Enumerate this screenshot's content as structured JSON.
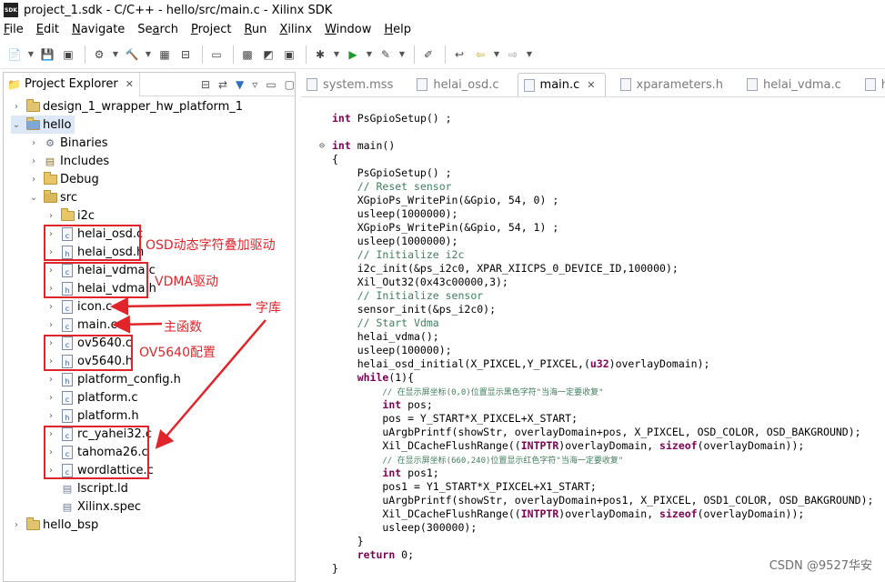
{
  "window": {
    "title": "project_1.sdk - C/C++ - hello/src/main.c - Xilinx SDK",
    "logo_text": "SDK"
  },
  "menu": [
    {
      "label": "File",
      "mn": "F",
      "rest": "ile"
    },
    {
      "label": "Edit",
      "mn": "E",
      "rest": "dit"
    },
    {
      "label": "Navigate",
      "mn": "N",
      "rest": "avigate"
    },
    {
      "label": "Search",
      "mn": "a",
      "pre": "Se",
      "rest": "rch"
    },
    {
      "label": "Project",
      "mn": "P",
      "rest": "roject"
    },
    {
      "label": "Run",
      "mn": "R",
      "rest": "un"
    },
    {
      "label": "Xilinx",
      "mn": "X",
      "rest": "ilinx"
    },
    {
      "label": "Window",
      "mn": "W",
      "rest": "indow"
    },
    {
      "label": "Help",
      "mn": "H",
      "rest": "elp"
    }
  ],
  "explorer": {
    "tab_label": "Project Explorer",
    "items": [
      {
        "label": "design_1_wrapper_hw_platform_1",
        "level": 0,
        "arrow": "›",
        "icon": "project-icon"
      },
      {
        "label": "hello",
        "level": 0,
        "arrow": "⌄",
        "icon": "c-project-icon",
        "selected": true
      },
      {
        "label": "Binaries",
        "level": 1,
        "arrow": "›",
        "icon": "binaries-icon"
      },
      {
        "label": "Includes",
        "level": 1,
        "arrow": "›",
        "icon": "includes-icon"
      },
      {
        "label": "Debug",
        "level": 1,
        "arrow": "›",
        "icon": "folder-icon"
      },
      {
        "label": "src",
        "level": 1,
        "arrow": "⌄",
        "icon": "source-folder-icon"
      },
      {
        "label": "i2c",
        "level": 2,
        "arrow": "›",
        "icon": "folder-icon"
      },
      {
        "label": "helai_osd.c",
        "level": 2,
        "arrow": "›",
        "icon": "c-file-icon"
      },
      {
        "label": "helai_osd.h",
        "level": 2,
        "arrow": "›",
        "icon": "h-file-icon"
      },
      {
        "label": "helai_vdma.c",
        "level": 2,
        "arrow": "›",
        "icon": "c-file-icon"
      },
      {
        "label": "helai_vdma.h",
        "level": 2,
        "arrow": "›",
        "icon": "h-file-icon"
      },
      {
        "label": "icon.c",
        "level": 2,
        "arrow": "›",
        "icon": "c-file-icon"
      },
      {
        "label": "main.c",
        "level": 2,
        "arrow": "›",
        "icon": "c-file-icon"
      },
      {
        "label": "ov5640.c",
        "level": 2,
        "arrow": "›",
        "icon": "c-file-icon"
      },
      {
        "label": "ov5640.h",
        "level": 2,
        "arrow": "›",
        "icon": "h-file-icon"
      },
      {
        "label": "platform_config.h",
        "level": 2,
        "arrow": "›",
        "icon": "h-file-icon"
      },
      {
        "label": "platform.c",
        "level": 2,
        "arrow": "›",
        "icon": "c-file-icon"
      },
      {
        "label": "platform.h",
        "level": 2,
        "arrow": "›",
        "icon": "h-file-icon"
      },
      {
        "label": "rc_yahei32.c",
        "level": 2,
        "arrow": "›",
        "icon": "c-file-icon"
      },
      {
        "label": "tahoma26.c",
        "level": 2,
        "arrow": "›",
        "icon": "c-file-icon"
      },
      {
        "label": "wordlattice.c",
        "level": 2,
        "arrow": "›",
        "icon": "c-file-icon"
      },
      {
        "label": "lscript.ld",
        "level": 2,
        "arrow": "",
        "icon": "linker-script-icon"
      },
      {
        "label": "Xilinx.spec",
        "level": 2,
        "arrow": "",
        "icon": "spec-file-icon"
      },
      {
        "label": "hello_bsp",
        "level": 0,
        "arrow": "›",
        "icon": "bsp-project-icon"
      }
    ]
  },
  "annotations": {
    "osd": "OSD动态字符叠加驱动",
    "vdma": "VDMA驱动",
    "font_lib": "字库",
    "main_fn": "主函数",
    "ov5640": "OV5640配置",
    "color": "#e0242a"
  },
  "editor": {
    "tabs": [
      {
        "label": "system.mss",
        "active": false
      },
      {
        "label": "helai_osd.c",
        "active": false
      },
      {
        "label": "main.c",
        "active": true
      },
      {
        "label": "xparameters.h",
        "active": false
      },
      {
        "label": "helai_vdma.c",
        "active": false
      },
      {
        "label": "helai_osd",
        "active": false
      }
    ],
    "code_lines": [
      [
        [
          "kw",
          "int"
        ],
        [
          "t",
          " PsGpioSetup() ;"
        ]
      ],
      [
        [
          "t",
          ""
        ]
      ],
      [
        [
          "kw",
          "int"
        ],
        [
          "t",
          " main()"
        ]
      ],
      [
        [
          "t",
          "{"
        ]
      ],
      [
        [
          "t",
          "    PsGpioSetup() ;"
        ]
      ],
      [
        [
          "t",
          "    "
        ],
        [
          "cm",
          "// Reset sensor"
        ]
      ],
      [
        [
          "t",
          "    XGpioPs_WritePin(&Gpio, 54, 0) ;"
        ]
      ],
      [
        [
          "t",
          "    usleep(1000000);"
        ]
      ],
      [
        [
          "t",
          "    XGpioPs_WritePin(&Gpio, 54, 1) ;"
        ]
      ],
      [
        [
          "t",
          "    usleep(1000000);"
        ]
      ],
      [
        [
          "t",
          "    "
        ],
        [
          "cm",
          "// Initialize i2c"
        ]
      ],
      [
        [
          "t",
          "    i2c_init(&ps_i2c0, XPAR_XIICPS_0_DEVICE_ID,100000);"
        ]
      ],
      [
        [
          "t",
          "    Xil_Out32(0x43c00000,3);"
        ]
      ],
      [
        [
          "t",
          "    "
        ],
        [
          "cm",
          "// Initialize sensor"
        ]
      ],
      [
        [
          "t",
          "    sensor_init(&ps_i2c0);"
        ]
      ],
      [
        [
          "t",
          "    "
        ],
        [
          "cm",
          "// Start Vdma"
        ]
      ],
      [
        [
          "t",
          "    helai_vdma();"
        ]
      ],
      [
        [
          "t",
          "    usleep(100000);"
        ]
      ],
      [
        [
          "t",
          "    helai_osd_initial(X_PIXCEL,Y_PIXCEL,("
        ],
        [
          "kw",
          "u32"
        ],
        [
          "t",
          ")overlayDomain);"
        ]
      ],
      [
        [
          "t",
          "    "
        ],
        [
          "kw",
          "while"
        ],
        [
          "t",
          "(1){"
        ]
      ],
      [
        [
          "t",
          "        "
        ],
        [
          "cmz",
          "// 在显示屏坐标(0,0)位置显示黑色字符\"当海一定要收复\""
        ]
      ],
      [
        [
          "t",
          "        "
        ],
        [
          "kw",
          "int"
        ],
        [
          "t",
          " pos;"
        ]
      ],
      [
        [
          "t",
          "        pos = Y_START*X_PIXCEL+X_START;"
        ]
      ],
      [
        [
          "t",
          "        uArgbPrintf(showStr, overlayDomain+pos, X_PIXCEL, OSD_COLOR, OSD_BAKGROUND);"
        ]
      ],
      [
        [
          "t",
          "        Xil_DCacheFlushRange(("
        ],
        [
          "kw",
          "INTPTR"
        ],
        [
          "t",
          ")overlayDomain, "
        ],
        [
          "kw",
          "sizeof"
        ],
        [
          "t",
          "(overlayDomain));"
        ]
      ],
      [
        [
          "t",
          "        "
        ],
        [
          "cmz",
          "// 在显示屏坐标(660,240)位置显示红色字符\"当海一定要收复\""
        ]
      ],
      [
        [
          "t",
          "        "
        ],
        [
          "kw",
          "int"
        ],
        [
          "t",
          " pos1;"
        ]
      ],
      [
        [
          "t",
          "        pos1 = Y1_START*X_PIXCEL+X1_START;"
        ]
      ],
      [
        [
          "t",
          "        uArgbPrintf(showStr, overlayDomain+pos1, X_PIXCEL, OSD1_COLOR, OSD_BAKGROUND);"
        ]
      ],
      [
        [
          "t",
          "        Xil_DCacheFlushRange(("
        ],
        [
          "kw",
          "INTPTR"
        ],
        [
          "t",
          ")overlayDomain, "
        ],
        [
          "kw",
          "sizeof"
        ],
        [
          "t",
          "(overlayDomain));"
        ]
      ],
      [
        [
          "t",
          "        usleep(300000);"
        ]
      ],
      [
        [
          "t",
          "    }"
        ]
      ],
      [
        [
          "t",
          "    "
        ],
        [
          "kw",
          "return"
        ],
        [
          "t",
          " 0;"
        ]
      ],
      [
        [
          "t",
          "}"
        ]
      ]
    ]
  },
  "watermark": "CSDN @9527华安"
}
